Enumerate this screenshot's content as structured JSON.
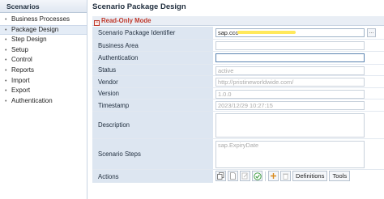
{
  "left": {
    "header": "Scenarios",
    "items": [
      {
        "label": "Business Processes",
        "selected": false
      },
      {
        "label": "Package Design",
        "selected": true
      },
      {
        "label": "Step Design",
        "selected": false
      },
      {
        "label": "Setup",
        "selected": false
      },
      {
        "label": "Control",
        "selected": false
      },
      {
        "label": "Reports",
        "selected": false
      },
      {
        "label": "Import",
        "selected": false
      },
      {
        "label": "Export",
        "selected": false
      },
      {
        "label": "Authentication",
        "selected": false
      }
    ]
  },
  "main": {
    "title": "Scenario Package Design",
    "mode": "Read-Only Mode",
    "fields": {
      "identifier": {
        "label": "Scenario Package Identifier",
        "value": "sap.cco",
        "button": "..."
      },
      "business_area": {
        "label": "Business Area",
        "value": ""
      },
      "authentication": {
        "label": "Authentication",
        "value": ""
      },
      "status": {
        "label": "Status",
        "value": "active"
      },
      "vendor": {
        "label": "Vendor",
        "value": "http://pristineworldwide.com/"
      },
      "version": {
        "label": "Version",
        "value": "1.0.0"
      },
      "timestamp": {
        "label": "Timestamp",
        "value": "2023/12/29 10:27:15"
      },
      "description": {
        "label": "Description",
        "value": ""
      },
      "steps": {
        "label": "Scenario Steps",
        "value": "sap.ExpiryDate"
      },
      "actions": {
        "label": "Actions"
      }
    },
    "actions": {
      "definitions": "Definitions",
      "tools": "Tools"
    }
  },
  "colors": {
    "label_bg": "#dde6f1",
    "readonly_text": "#c0392b",
    "highlight": "#ffe74a"
  }
}
